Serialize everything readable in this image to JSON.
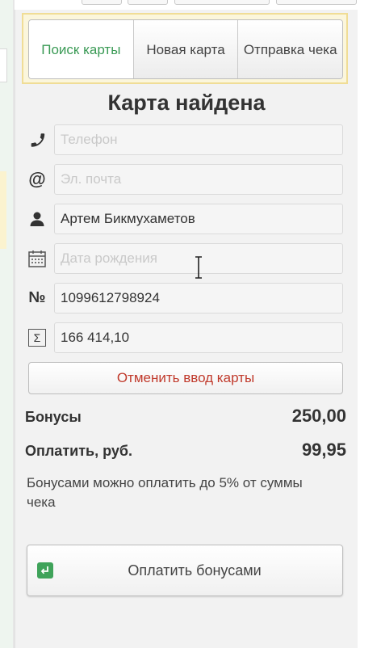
{
  "tabs": [
    {
      "label": "Поиск карты",
      "active": true
    },
    {
      "label": "Новая карта",
      "active": false
    },
    {
      "label": "Отправка чека",
      "active": false
    }
  ],
  "status_title": "Карта найдена",
  "fields": {
    "phone": {
      "value": "",
      "placeholder": "Телефон",
      "icon": "phone-icon"
    },
    "email": {
      "value": "",
      "placeholder": "Эл. почта",
      "icon": "at-icon"
    },
    "name": {
      "value": "Артем Бикмухаметов",
      "placeholder": "",
      "icon": "person-icon"
    },
    "birthdate": {
      "value": "",
      "placeholder": "Дата рождения",
      "icon": "calendar-icon"
    },
    "card_number": {
      "value": "1099612798924",
      "icon_text": "№",
      "icon": "number-sign-icon"
    },
    "total": {
      "value": "166 414,10",
      "icon_text": "Σ",
      "icon": "sigma-icon"
    }
  },
  "cancel_button_label": "Отменить ввод карты",
  "summary": {
    "bonus_label": "Бонусы",
    "bonus_value": "250,00",
    "pay_label": "Оплатить, руб.",
    "pay_value": "99,95"
  },
  "note": "Бонусами можно оплатить до 5% от суммы чека",
  "pay_button": {
    "label": "Оплатить бонусами",
    "icon": "enter-arrow-icon"
  },
  "colors": {
    "active_tab": "#3a9a55",
    "cancel_text": "#c0392b",
    "pay_icon_bg": "#3fa35a",
    "tabs_frame": "#f0dd96"
  }
}
